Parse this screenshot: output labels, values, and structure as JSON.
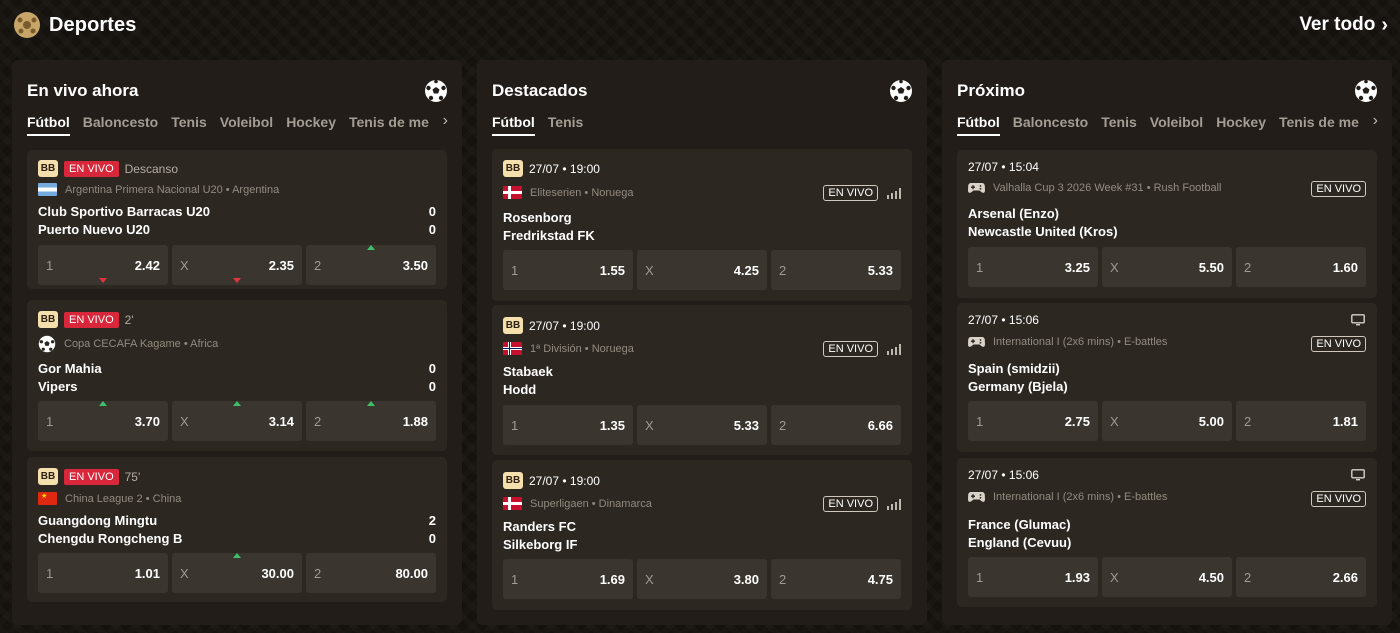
{
  "header": {
    "title": "Deportes",
    "view_all": "Ver todo"
  },
  "panels": [
    {
      "title": "En vivo ahora",
      "tabs": [
        "Fútbol",
        "Baloncesto",
        "Tenis",
        "Voleibol",
        "Hockey",
        "Tenis de me"
      ],
      "cards": [
        {
          "bb": "BB",
          "live": "EN VIVO",
          "status": "Descanso",
          "league": "Argentina Primera Nacional U20 • Argentina",
          "home": "Club Sportivo Barracas U20",
          "away": "Puerto Nuevo U20",
          "home_score": "0",
          "away_score": "0",
          "odds": [
            {
              "label": "1",
              "value": "2.42",
              "trend": "down"
            },
            {
              "label": "X",
              "value": "2.35",
              "trend": "down"
            },
            {
              "label": "2",
              "value": "3.50",
              "trend": "up"
            }
          ]
        },
        {
          "bb": "BB",
          "live": "EN VIVO",
          "status": "2'",
          "league": "Copa CECAFA Kagame • Africa",
          "home": "Gor Mahia",
          "away": "Vipers",
          "home_score": "0",
          "away_score": "0",
          "odds": [
            {
              "label": "1",
              "value": "3.70",
              "trend": "up"
            },
            {
              "label": "X",
              "value": "3.14",
              "trend": "up"
            },
            {
              "label": "2",
              "value": "1.88",
              "trend": "up"
            }
          ]
        },
        {
          "bb": "BB",
          "live": "EN VIVO",
          "status": "75'",
          "league": "China League 2 • China",
          "home": "Guangdong Mingtu",
          "away": "Chengdu Rongcheng B",
          "home_score": "2",
          "away_score": "0",
          "odds": [
            {
              "label": "1",
              "value": "1.01",
              "trend": ""
            },
            {
              "label": "X",
              "value": "30.00",
              "trend": "up"
            },
            {
              "label": "2",
              "value": "80.00",
              "trend": ""
            }
          ]
        }
      ]
    },
    {
      "title": "Destacados",
      "tabs": [
        "Fútbol",
        "Tenis"
      ],
      "cards": [
        {
          "bb": "BB",
          "datetime": "27/07 • 19:00",
          "live": "EN VIVO",
          "league": "Eliteserien • Noruega",
          "home": "Rosenborg",
          "away": "Fredrikstad FK",
          "odds": [
            {
              "label": "1",
              "value": "1.55"
            },
            {
              "label": "X",
              "value": "4.25"
            },
            {
              "label": "2",
              "value": "5.33"
            }
          ]
        },
        {
          "bb": "BB",
          "datetime": "27/07 • 19:00",
          "live": "EN VIVO",
          "league": "1ª División • Noruega",
          "home": "Stabaek",
          "away": "Hodd",
          "odds": [
            {
              "label": "1",
              "value": "1.35"
            },
            {
              "label": "X",
              "value": "5.33"
            },
            {
              "label": "2",
              "value": "6.66"
            }
          ]
        },
        {
          "bb": "BB",
          "datetime": "27/07 • 19:00",
          "live": "EN VIVO",
          "league": "Superligaen • Dinamarca",
          "home": "Randers FC",
          "away": "Silkeborg IF",
          "odds": [
            {
              "label": "1",
              "value": "1.69"
            },
            {
              "label": "X",
              "value": "3.80"
            },
            {
              "label": "2",
              "value": "4.75"
            }
          ]
        }
      ]
    },
    {
      "title": "Próximo",
      "tabs": [
        "Fútbol",
        "Baloncesto",
        "Tenis",
        "Voleibol",
        "Hockey",
        "Tenis de me"
      ],
      "cards": [
        {
          "datetime": "27/07 • 15:04",
          "live": "EN VIVO",
          "league": "Valhalla Cup 3 2026 Week #31 • Rush Football",
          "home": "Arsenal (Enzo)",
          "away": "Newcastle United (Kros)",
          "odds": [
            {
              "label": "1",
              "value": "3.25"
            },
            {
              "label": "X",
              "value": "5.50"
            },
            {
              "label": "2",
              "value": "1.60"
            }
          ]
        },
        {
          "datetime": "27/07 • 15:06",
          "live": "EN VIVO",
          "league": "International I (2x6 mins) • E-battles",
          "home": "Spain (smidzii)",
          "away": "Germany (Bjela)",
          "odds": [
            {
              "label": "1",
              "value": "2.75"
            },
            {
              "label": "X",
              "value": "5.00"
            },
            {
              "label": "2",
              "value": "1.81"
            }
          ]
        },
        {
          "datetime": "27/07 • 15:06",
          "live": "EN VIVO",
          "league": "International I (2x6 mins) • E-battles",
          "home": "France (Glumac)",
          "away": "England (Cevuu)",
          "odds": [
            {
              "label": "1",
              "value": "1.93"
            },
            {
              "label": "X",
              "value": "4.50"
            },
            {
              "label": "2",
              "value": "2.66"
            }
          ]
        }
      ]
    }
  ],
  "icons": {
    "header": "sports-ball-icon",
    "view_all": "chevron-right-icon",
    "panel": "soccer-ball-icon",
    "tab_scroll": "chevron-right-icon",
    "signal": "signal-bars-icon",
    "tv": "tv-icon",
    "esports": "gamepad-icon"
  },
  "colors": {
    "background": "#15120e",
    "panel": "#221d18",
    "card": "#2d2721",
    "odd": "#3b352f",
    "live_badge": "#d8273b",
    "bb_badge": "#f4dfad",
    "up": "#3fbf6a",
    "down": "#e0353f"
  }
}
